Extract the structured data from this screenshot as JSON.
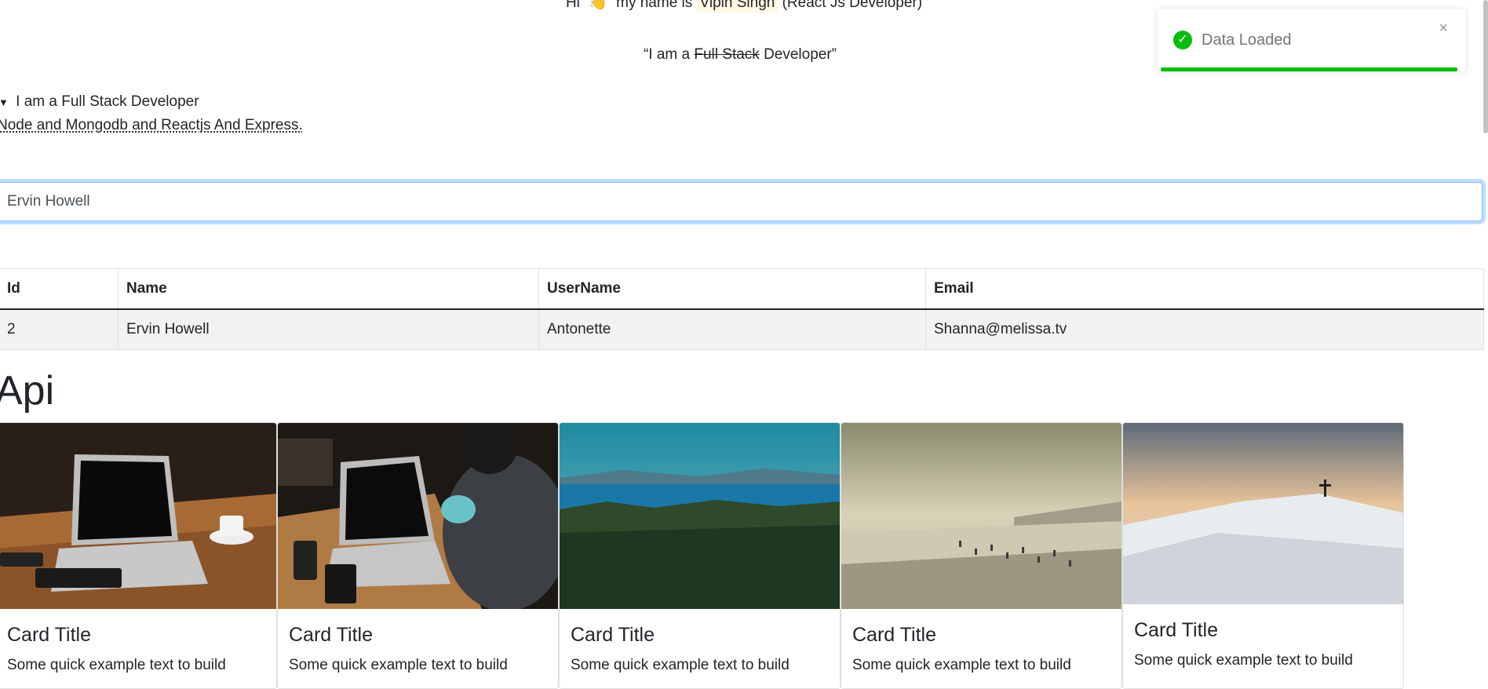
{
  "greeting": {
    "prefix": "Hi",
    "wave": "👋",
    "middle": "my name is",
    "name": "Vipin Singh",
    "suffix": "(React Js Developer)"
  },
  "quote": {
    "open": "“I am a ",
    "struck": "Full Stack",
    "close": " Developer”"
  },
  "details": {
    "summary": "I am a Full Stack Developer",
    "body": "Node and Mongodb and Reactjs And Express."
  },
  "search": {
    "value": "Ervin Howell"
  },
  "table": {
    "headers": [
      "Id",
      "Name",
      "UserName",
      "Email"
    ],
    "rows": [
      [
        "2",
        "Ervin Howell",
        "Antonette",
        "Shanna@melissa.tv"
      ]
    ]
  },
  "api": {
    "heading": "Api"
  },
  "cards": [
    {
      "title": "Card Title",
      "text": "Some quick example text to build"
    },
    {
      "title": "Card Title",
      "text": "Some quick example text to build"
    },
    {
      "title": "Card Title",
      "text": "Some quick example text to build"
    },
    {
      "title": "Card Title",
      "text": "Some quick example text to build"
    },
    {
      "title": "Card Title",
      "text": "Some quick example text to build"
    }
  ],
  "toast": {
    "message": "Data Loaded",
    "close": "×",
    "color": "#07bc0c"
  }
}
